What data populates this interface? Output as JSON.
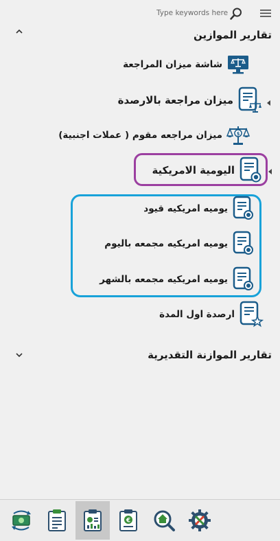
{
  "search": {
    "placeholder": "Type keywords here"
  },
  "sections": {
    "balance_reports": "تقارير الموازين",
    "estimated_budget_reports": "تقارير الموازنة التقديرية"
  },
  "items": {
    "trial_balance_screen": "شاشة ميزان المراجعة",
    "trial_balance_with_balances": "ميزان مراجعة بالارصدة",
    "valued_trial_balance": "ميزان مراجعه مقوم ( عملات اجنبية)",
    "american_journal": "اليومية الامريكية",
    "american_journal_entries": "يوميه امريكيه قيود",
    "american_journal_by_day": "يوميه امريكيه مجمعه باليوم",
    "american_journal_by_month": "يوميه امريكيه مجمعه بالشهر",
    "opening_balances": "ارصدة اول المدة"
  },
  "colors": {
    "icon_blue": "#1b5c8a",
    "purple_outline": "#9b3fa0",
    "blue_outline": "#18a2d9"
  },
  "toolbar_icons": [
    "money-transfer-icon",
    "clipboard-icon",
    "report-chart-icon",
    "document-currency-icon",
    "home-search-icon",
    "settings-tools-icon"
  ],
  "toolbar_active_index": 2
}
